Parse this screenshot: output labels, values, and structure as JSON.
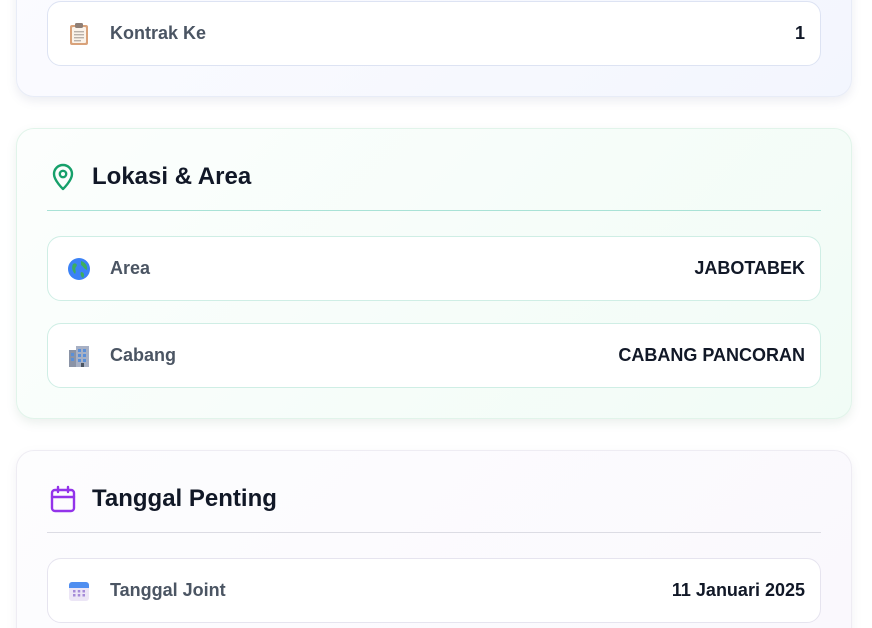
{
  "contract_section": {
    "rows": [
      {
        "icon": "clipboard-icon",
        "label": "Kontrak Ke",
        "value": "1"
      }
    ]
  },
  "location_section": {
    "title": "Lokasi & Area",
    "icon": "map-pin-icon",
    "accent": "#16a06a",
    "rows": [
      {
        "icon": "globe-icon",
        "label": "Area",
        "value": "JABOTABEK"
      },
      {
        "icon": "office-building-icon",
        "label": "Cabang",
        "value": "CABANG PANCORAN"
      }
    ]
  },
  "dates_section": {
    "title": "Tanggal Penting",
    "icon": "calendar-icon",
    "accent": "#9333ea",
    "rows": [
      {
        "icon": "calendar-emoji-icon",
        "label": "Tanggal Joint",
        "value": "11 Januari 2025"
      }
    ]
  }
}
